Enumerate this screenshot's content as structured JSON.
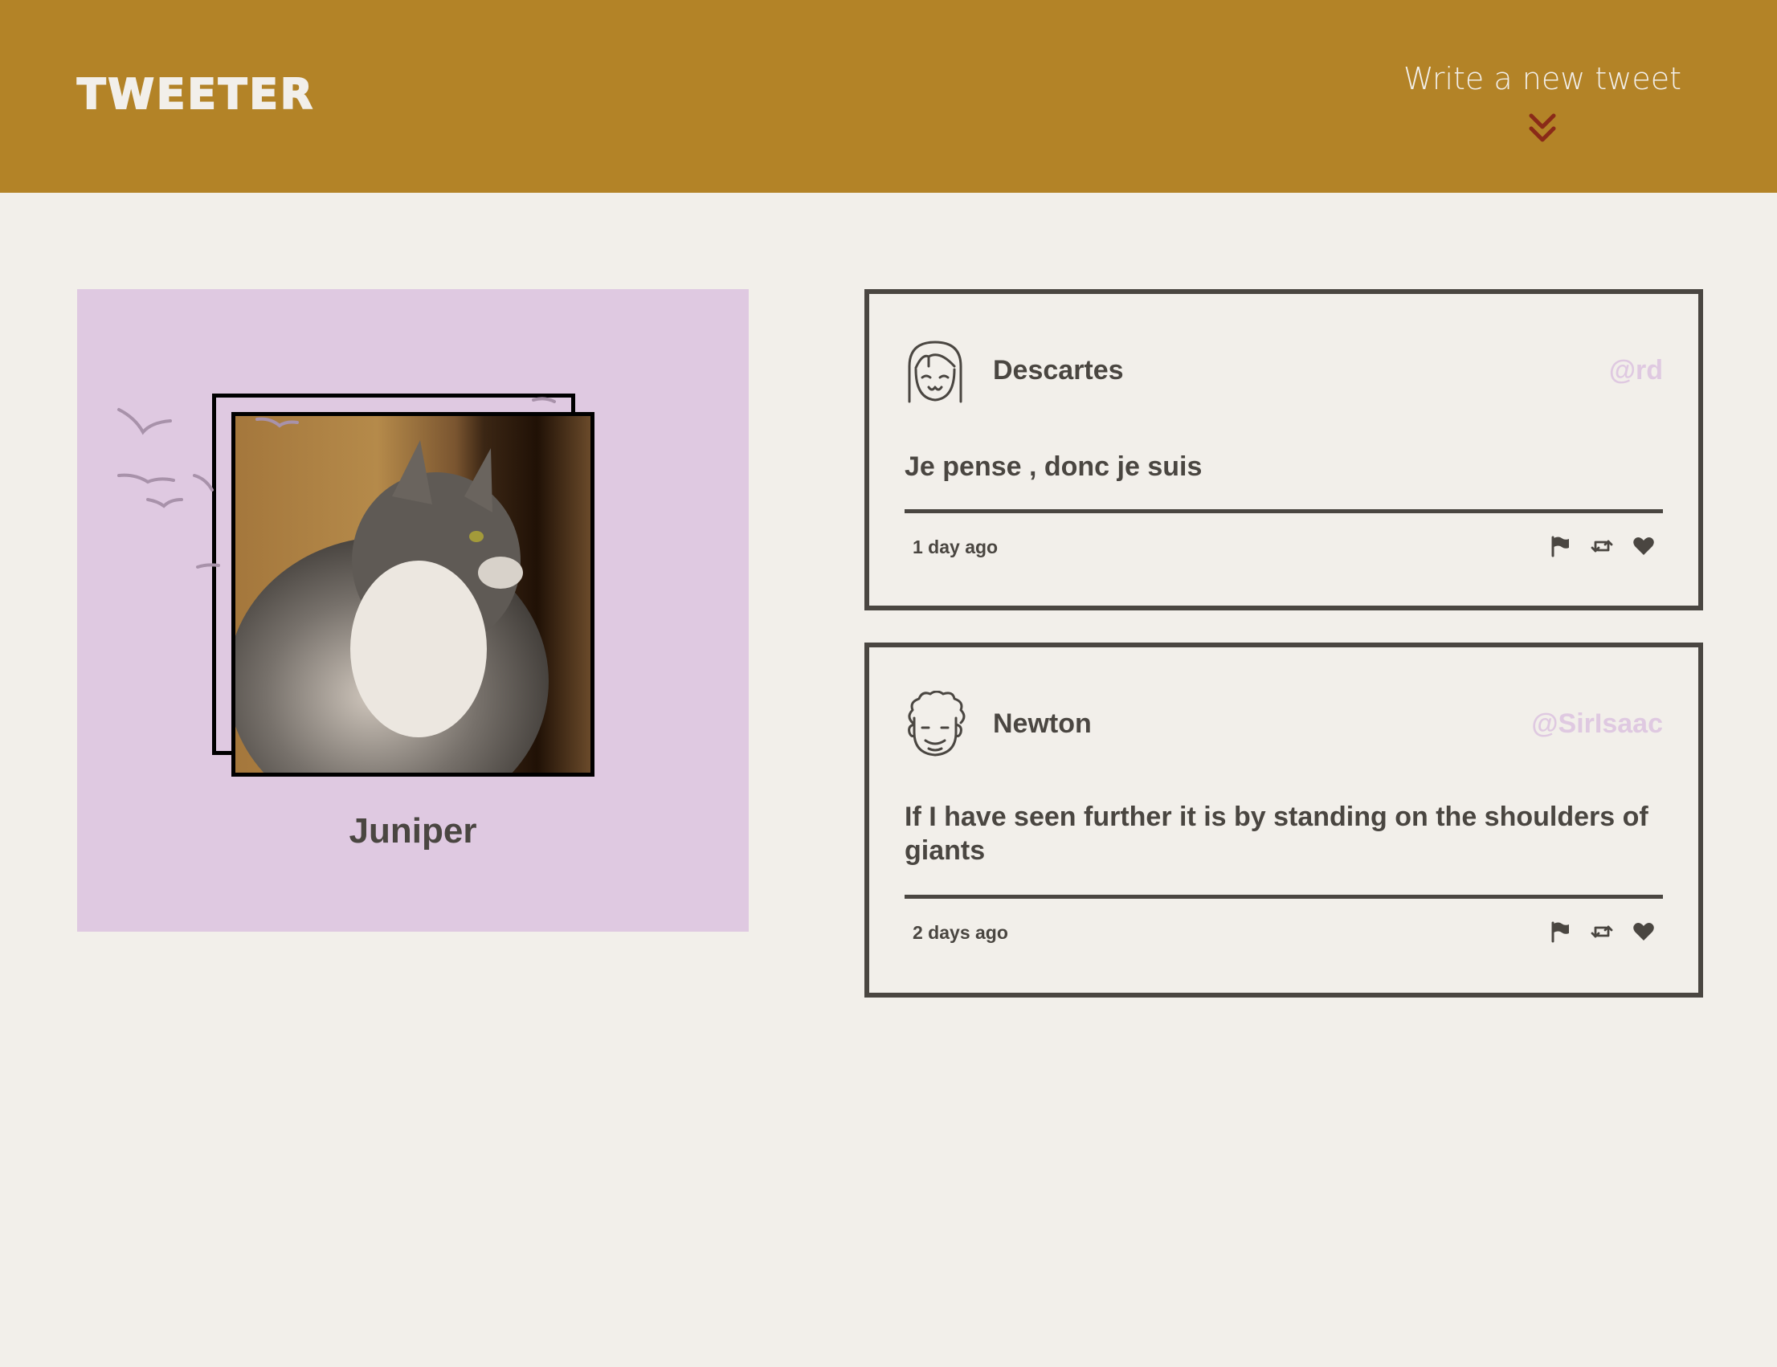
{
  "nav": {
    "brand": "Tweeter",
    "compose_label": "Write a new tweet",
    "compose_icon": "double-chevron-down-icon",
    "compose_icon_color": "#8a2a18",
    "background_color": "#b38327"
  },
  "profile": {
    "name": "Juniper",
    "background_color": "#dfc9e1"
  },
  "tweets": [
    {
      "name": "Descartes",
      "handle": "@rd",
      "content": "Je pense , donc je suis",
      "time": "1 day ago",
      "avatar_icon": "girl-face-icon"
    },
    {
      "name": "Newton",
      "handle": "@SirIsaac",
      "content": "If I have seen further it is by standing on the shoulders of giants",
      "time": "2 days ago",
      "avatar_icon": "curly-hair-face-icon"
    }
  ],
  "actions": {
    "flag_icon": "flag-icon",
    "retweet_icon": "retweet-icon",
    "like_icon": "heart-icon"
  },
  "colors": {
    "page_background": "#f2efea",
    "text": "#4a4641",
    "handle": "#dfc9e1"
  }
}
